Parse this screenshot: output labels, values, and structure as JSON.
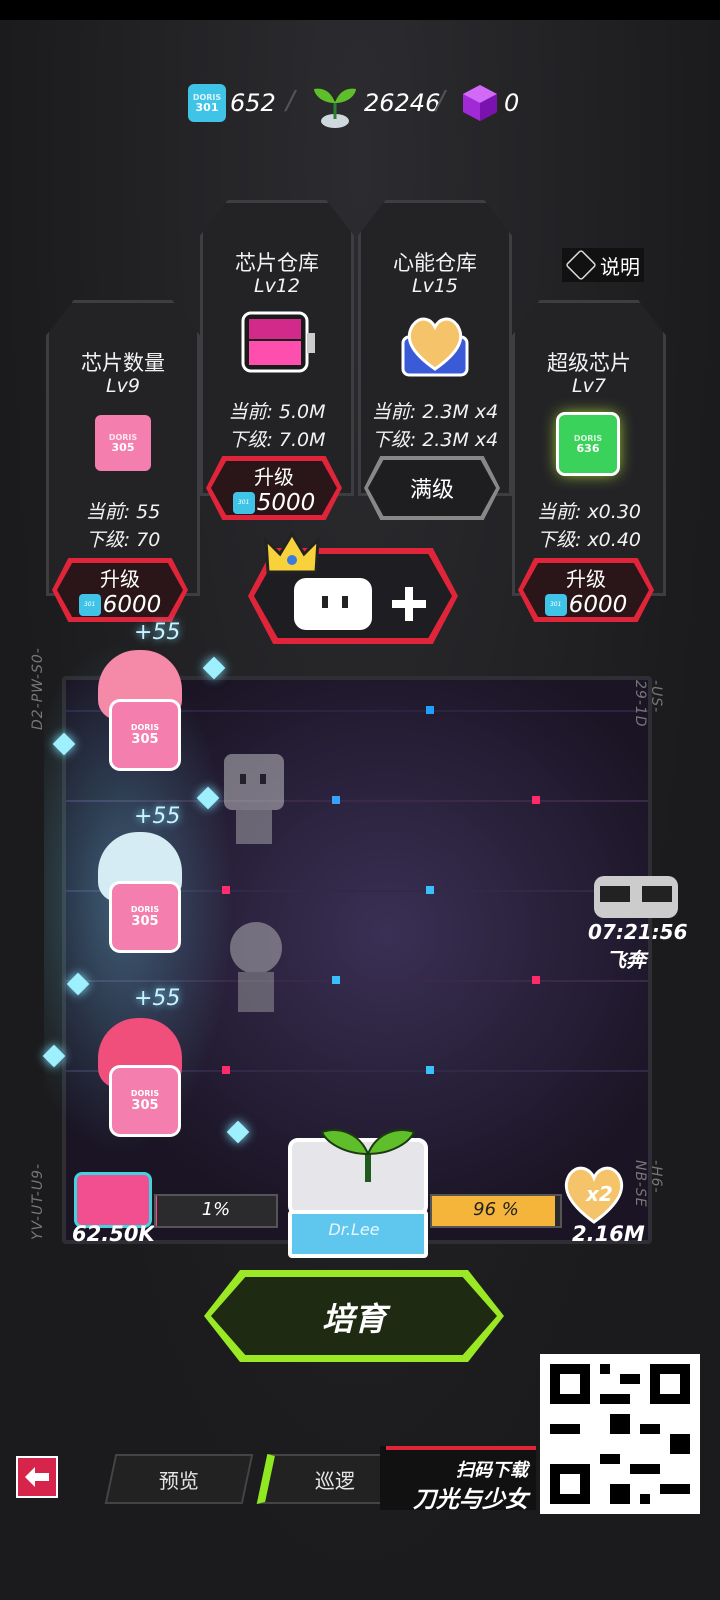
{
  "currency": {
    "chips": "652",
    "sprouts": "26246",
    "cubes": "0",
    "chip_icon_label": "DORIS",
    "chip_icon_num": "301"
  },
  "help": {
    "label": "说明"
  },
  "panels": {
    "chip_count": {
      "title": "芯片数量",
      "level": "Lv9",
      "chip_label": "DORIS",
      "chip_num": "305",
      "current": "当前: 55",
      "next": "下级: 70",
      "button": "升级",
      "cost": "6000"
    },
    "chip_storage": {
      "title": "芯片仓库",
      "level": "Lv12",
      "current": "当前: 5.0M",
      "next": "下级: 7.0M",
      "button": "升级",
      "cost": "5000"
    },
    "heart_storage": {
      "title": "心能仓库",
      "level": "Lv15",
      "current": "当前: 2.3M x4",
      "next": "下级: 2.3M x4",
      "button": "满级"
    },
    "super_chip": {
      "title": "超级芯片",
      "level": "Lv7",
      "chip_label": "DORIS",
      "chip_num": "636",
      "current": "当前: x0.30",
      "next": "下级: x0.40",
      "button": "升级",
      "cost": "6000"
    }
  },
  "field": {
    "left_top_label": "D2-PW-S0-",
    "right_top_label": "-US-29-1D",
    "left_bottom_label": "YV-UT-U9-",
    "right_bottom_label": "-H6-NB-SE",
    "gains": [
      "+55",
      "+55",
      "+55"
    ],
    "char_chip_label": "DORIS",
    "char_chip_num": "305",
    "timer": "07:21:56",
    "timer_label": "飞奔"
  },
  "bottom_bar": {
    "left_value": "62.50K",
    "left_percent": "1%",
    "left_percent_value": 0.01,
    "right_percent": "96 %",
    "right_percent_value": 0.96,
    "multiplier": "x2",
    "right_value": "2.16M",
    "machine_label": "Dr.Lee"
  },
  "cultivate_button": "培育",
  "nav": {
    "preview": "预览",
    "patrol": "巡逻"
  },
  "promo": {
    "scan": "扫码下载",
    "title": "刀光与少女"
  },
  "colors": {
    "red": "#e0243a",
    "green": "#9be824",
    "pink": "#f47fae",
    "cyan": "#3fc4e8",
    "gold": "#f5b53a"
  }
}
